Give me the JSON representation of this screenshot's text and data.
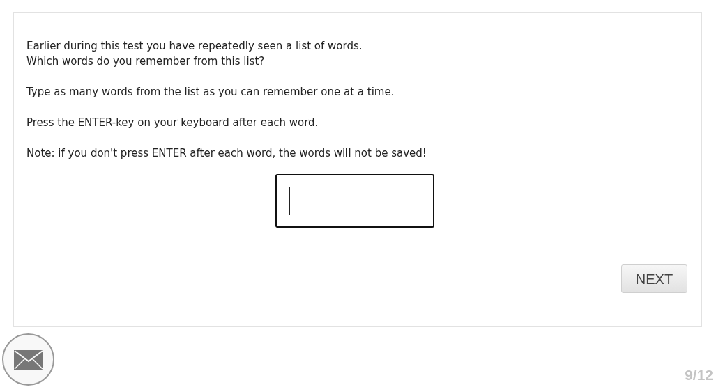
{
  "instructions": [
    {
      "kind": "text",
      "text": "Earlier during this test you have repeatedly seen a list of words.\nWhich words do you remember from this list?"
    },
    {
      "kind": "text",
      "text": "Type as many words from the list as you can remember one at a time."
    },
    {
      "kind": "link",
      "before": "Press the ",
      "link": "ENTER-key",
      "after": " on your keyboard after each word."
    },
    {
      "kind": "text",
      "text": "Note: if you don't press ENTER after each word, the words will not be saved!"
    }
  ],
  "answer": {
    "focused": true
  },
  "next_button": "NEXT",
  "progress": "9/12"
}
